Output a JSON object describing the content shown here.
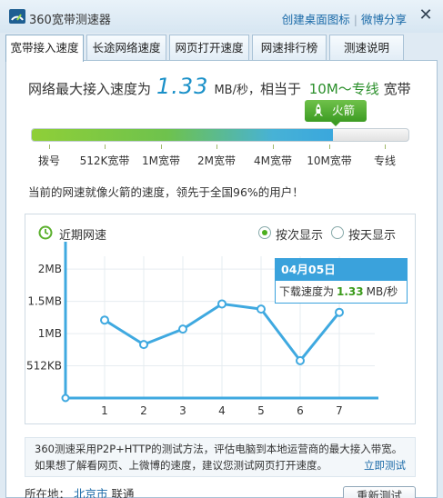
{
  "titlebar": {
    "title": "360宽带测速器",
    "links": [
      "创建桌面图标",
      "微博分享"
    ],
    "close": "✕"
  },
  "tabs": [
    "宽带接入速度",
    "长途网络速度",
    "网页打开速度",
    "网速排行榜",
    "测速说明"
  ],
  "active_tab": 0,
  "result": {
    "prefix": "网络最大接入速度为",
    "speed": "1.33",
    "unit": "MB/秒，",
    "equiv_prefix": "相当于",
    "equiv": "10M～专线",
    "suffix": "宽带",
    "badge": "火箭"
  },
  "scale": {
    "labels": [
      "拨号",
      "512K宽带",
      "1M宽带",
      "2M宽带",
      "4M宽带",
      "10M宽带",
      "专线"
    ],
    "fill_fraction": 0.8
  },
  "compare_text": "当前的网速就像火箭的速度，领先于全国96%的用户！",
  "chart": {
    "title": "近期网速",
    "radio_options": [
      "按次显示",
      "按天显示"
    ],
    "selected_option": 0,
    "tooltip": {
      "date": "04月05日",
      "label": "下载速度为",
      "value": "1.33",
      "unit": "MB/秒"
    }
  },
  "chart_data": {
    "type": "line",
    "x": [
      1,
      2,
      3,
      4,
      5,
      6,
      7
    ],
    "y_ticks": [
      "512KB",
      "1MB",
      "1.5MB",
      "2MB"
    ],
    "y_tick_values": [
      0.5,
      1.0,
      1.5,
      2.0
    ],
    "ylim": [
      0,
      2.2
    ],
    "series": [
      {
        "values": [
          1.21,
          0.83,
          1.07,
          1.46,
          1.38,
          0.58,
          1.33
        ]
      }
    ],
    "grid": true,
    "colors": {
      "line": "#3fa9e0",
      "grid": "#e6ecf0",
      "axis": "#3fa9e0"
    }
  },
  "info": {
    "line1": "360测速采用P2P+HTTP的测试方法，评估电脑到本地运营商的最大接入带宽。",
    "line2": "如果想了解看网页、上微博的速度，建议您测试网页打开速度。",
    "link": "立即测试"
  },
  "location": {
    "label": "所在地：",
    "city": "北京市",
    "isp": "联通"
  },
  "retest_button": "重新测试"
}
